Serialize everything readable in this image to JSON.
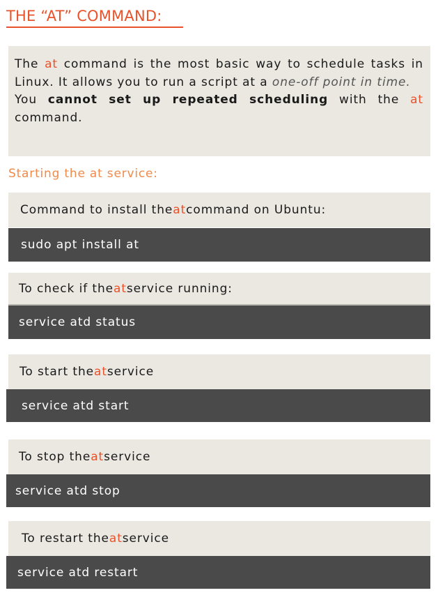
{
  "title": "THE “AT” COMMAND:",
  "intro": {
    "p1_a": "The ",
    "p1_at": "at",
    "p1_b": " command is the most basic way to schedule tasks in Linux. It allows you to run a script at a ",
    "p1_italic": "one-off point in time.",
    "p2_a": "You ",
    "p2_bold": "cannot set up repeated scheduling",
    "p2_b": " with the ",
    "p2_at": "at",
    "p2_c": " command."
  },
  "subheading": "Starting the at service:",
  "sections": [
    {
      "pre": "Command to install the ",
      "hl": "at",
      "post": " command on Ubuntu:",
      "command": "sudo apt install at"
    },
    {
      "pre": "To check if the ",
      "hl": "at",
      "post": " service running:",
      "command": "service atd status"
    },
    {
      "pre": "To start the ",
      "hl": "at",
      "post": " service",
      "command": "service atd start"
    },
    {
      "pre": "To stop the ",
      "hl": "at",
      "post": " service",
      "command": "service atd stop"
    },
    {
      "pre": "To restart the ",
      "hl": "at",
      "post": " service",
      "command": "service atd restart"
    }
  ],
  "colors": {
    "accent": "#e8532b",
    "subheading": "#f08a4b",
    "panel": "#ebe7e1",
    "code_bg": "#4a4a4a"
  }
}
